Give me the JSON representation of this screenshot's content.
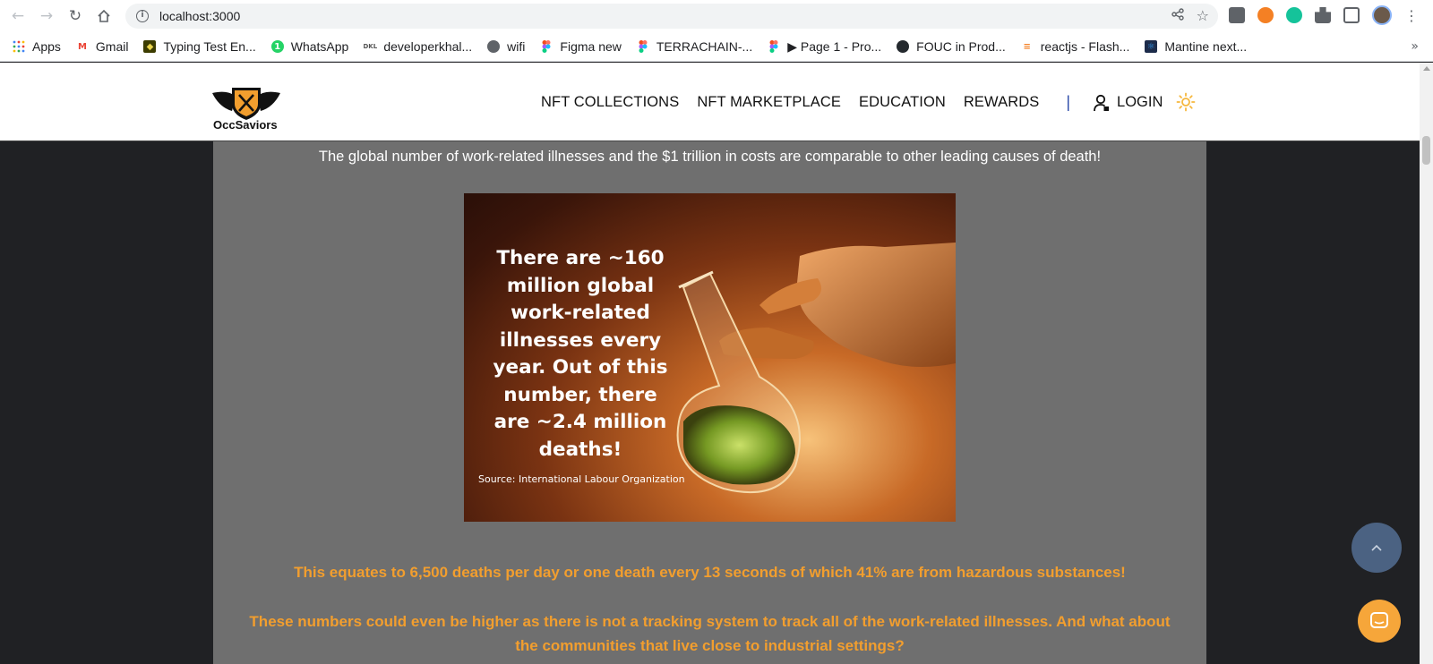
{
  "browser": {
    "url": "localhost:3000",
    "bookmarks": [
      {
        "label": "Apps",
        "icon": "apps-grid-icon",
        "color": "#4285f4"
      },
      {
        "label": "Gmail",
        "icon": "gmail-icon",
        "color": "#ea4335"
      },
      {
        "label": "Typing Test En...",
        "icon": "typing-test-icon",
        "color": "#3c3c00"
      },
      {
        "label": "WhatsApp",
        "icon": "whatsapp-icon",
        "color": "#25d366"
      },
      {
        "label": "developerkhal...",
        "icon": "developer-icon",
        "color": "#555555"
      },
      {
        "label": "wifi",
        "icon": "globe-icon",
        "color": "#5f6368"
      },
      {
        "label": "Figma new",
        "icon": "figma-icon",
        "color": "#f24e1e"
      },
      {
        "label": "TERRACHAIN-...",
        "icon": "figma-icon",
        "color": "#f24e1e"
      },
      {
        "label": "▶ Page 1 - Pro...",
        "icon": "figma-icon",
        "color": "#f24e1e"
      },
      {
        "label": "FOUC in Prod...",
        "icon": "github-icon",
        "color": "#24292e"
      },
      {
        "label": "reactjs - Flash...",
        "icon": "stackoverflow-icon",
        "color": "#f48024"
      },
      {
        "label": "Mantine next...",
        "icon": "mantine-icon",
        "color": "#339af0"
      }
    ],
    "more_label": "»"
  },
  "header": {
    "logo_text": "OccSaviors",
    "nav": [
      "NFT COLLECTIONS",
      "NFT MARKETPLACE",
      "EDUCATION",
      "REWARDS"
    ],
    "separator": "|",
    "login_label": "LOGIN"
  },
  "main": {
    "intro": "The global number of work-related illnesses and the $1 trillion in costs are comparable to other leading causes of death!",
    "image_text": "There are ~160 million global work-related illnesses every year. Out of this number, there are ~2.4 million deaths!",
    "image_source": "Source: International Labour Organization",
    "highlight1": "This equates to 6,500 deaths per day or one death every 13 seconds of which 41% are from hazardous substances!",
    "highlight2": "These numbers could even be higher as there is not a tracking system to track all of the work-related illnesses. And what about the communities that live close to industrial settings?"
  },
  "colors": {
    "accent": "#f29e2e",
    "content_bg": "#6f6f6f",
    "scroll_top_bg": "#4b6282",
    "chat_bg": "#f6a63a"
  }
}
